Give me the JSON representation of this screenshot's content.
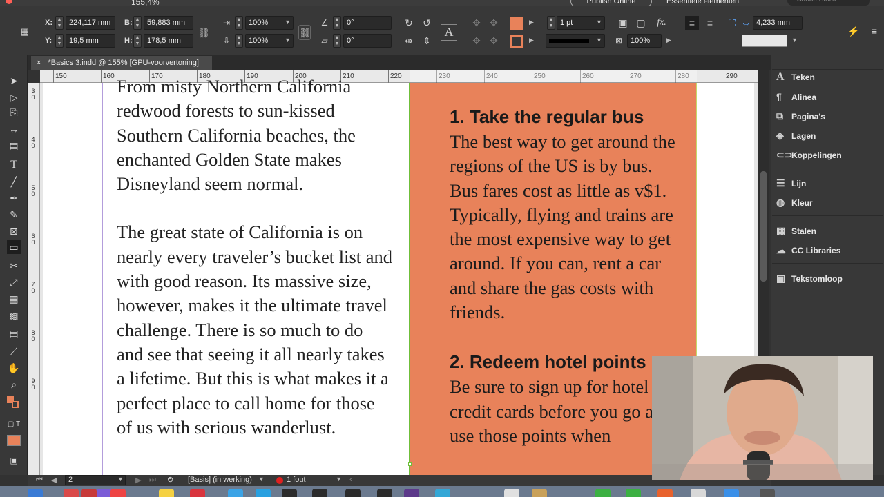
{
  "window": {
    "tab_title": "*Basics 3.indd @ 155% [GPU-voorvertoning]",
    "tab_close": "×"
  },
  "header": {
    "publish_label": "Publish Online",
    "workspace_label": "Essentiële elementen",
    "search_placeholder": "Adobe Stock",
    "zoom": "155,4%"
  },
  "control": {
    "x_label": "X:",
    "x_value": "224,117 mm",
    "y_label": "Y:",
    "y_value": "19,5 mm",
    "w_label": "B:",
    "w_value": "59,883 mm",
    "h_label": "H:",
    "h_value": "178,5 mm",
    "scale_x": "100%",
    "scale_y": "100%",
    "rotate": "0°",
    "shear": "0°",
    "stroke_weight": "1 pt",
    "opacity": "100%",
    "gap_value": "4,233 mm",
    "fill_color": "#e8825a",
    "stroke_color": "#e8825a"
  },
  "ruler": {
    "marks": [
      "150",
      "160",
      "170",
      "180",
      "190",
      "200",
      "210",
      "220",
      "230",
      "240",
      "250",
      "260",
      "270",
      "280",
      "290"
    ],
    "vmarks": [
      "3\n0",
      "4\n0",
      "5\n0",
      "6\n0",
      "7\n0",
      "8\n0",
      "9\n0"
    ]
  },
  "document": {
    "left_paragraphs": [
      "From misty Northern California redwood forests to sun-kissed Southern California beaches, the enchanted Golden State makes Disneyland seem normal.",
      "The great state of California is on nearly every traveler’s bucket list and with good reason. Its massive size, however, makes it the ultimate travel challenge. There is so much to do and see that seeing it all nearly takes a lifetime. But this is what makes it a perfect place to call home for those of us with serious wanderlust."
    ],
    "tip1_heading": "1. Take the regular bus",
    "tip1_body": "The best way to get around the regions of the US is by bus. Bus fares cost as little as v$1. Typically, flying and trains are the most expensive way to get around. If you can, rent a car and share the gas costs with friends.",
    "tip2_heading": "2. Redeem hotel points",
    "tip2_body": "Be sure to sign up for hotel credit cards before you go and use those points when"
  },
  "panels": {
    "items": [
      {
        "label": "Teken",
        "icon": "character-icon"
      },
      {
        "label": "Alinea",
        "icon": "paragraph-icon"
      },
      {
        "label": "Pagina's",
        "icon": "pages-icon"
      },
      {
        "label": "Lagen",
        "icon": "layers-icon"
      },
      {
        "label": "Koppelingen",
        "icon": "links-icon"
      },
      {
        "label": "Lijn",
        "icon": "stroke-icon"
      },
      {
        "label": "Kleur",
        "icon": "color-icon"
      },
      {
        "label": "Stalen",
        "icon": "swatches-icon"
      },
      {
        "label": "CC Libraries",
        "icon": "cc-libraries-icon"
      },
      {
        "label": "Tekstomloop",
        "icon": "text-wrap-icon"
      }
    ]
  },
  "status": {
    "page": "2",
    "master": "[Basis] (in werking)",
    "errors": "1 fout"
  },
  "colors": {
    "accent_orange": "#e8825a",
    "error_red": "#e02020"
  }
}
